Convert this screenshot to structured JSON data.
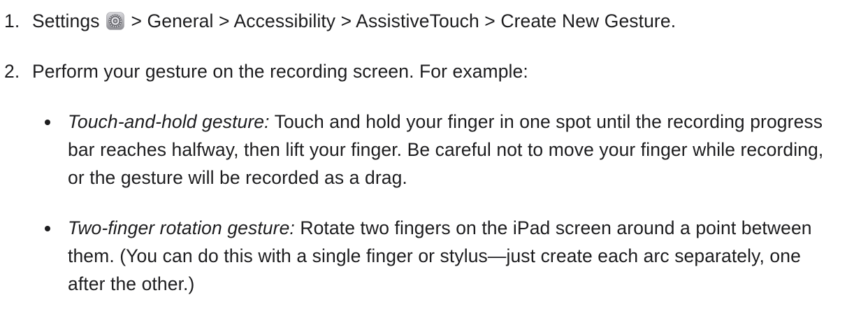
{
  "steps": [
    {
      "number": "1.",
      "text_before_icon": "Settings ",
      "icon": "settings-gear-icon",
      "text_after_icon": " > General > Accessibility > AssistiveTouch > Create New Gesture."
    },
    {
      "number": "2.",
      "text": "Perform your gesture on the recording screen. For example:"
    }
  ],
  "examples": [
    {
      "term": "Touch-and-hold gesture:",
      "description": " Touch and hold your finger in one spot until the recording progress bar reaches halfway, then lift your finger. Be careful not to move your finger while recording, or the gesture will be recorded as a drag."
    },
    {
      "term": "Two-finger rotation gesture:",
      "description": " Rotate two fingers on the iPad screen around a point between them. (You can do this with a single finger or stylus—just create each arc separately, one after the other.)"
    }
  ]
}
